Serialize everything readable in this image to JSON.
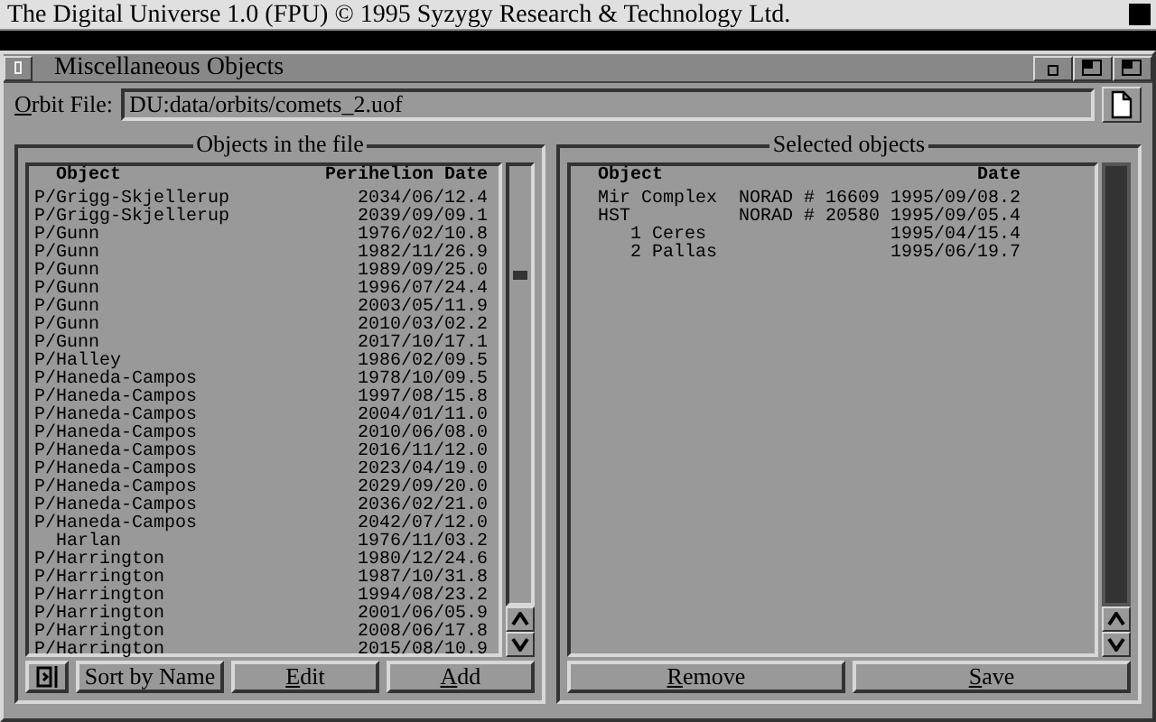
{
  "screen_title": "The Digital Universe 1.0 (FPU) © 1995 Syzygy Research & Technology Ltd.",
  "window": {
    "title": "Miscellaneous Objects"
  },
  "orbit_file": {
    "label": "Orbit File:",
    "value": "DU:data/orbits/comets_2.uof"
  },
  "file_panel": {
    "title": "Objects in the file",
    "columns": [
      "Object",
      "Perihelion Date"
    ],
    "rows": [
      {
        "object": "P/Grigg-Skjellerup",
        "date": "2034/06/12.4"
      },
      {
        "object": "P/Grigg-Skjellerup",
        "date": "2039/09/09.1"
      },
      {
        "object": "P/Gunn",
        "date": "1976/02/10.8"
      },
      {
        "object": "P/Gunn",
        "date": "1982/11/26.9"
      },
      {
        "object": "P/Gunn",
        "date": "1989/09/25.0"
      },
      {
        "object": "P/Gunn",
        "date": "1996/07/24.4"
      },
      {
        "object": "P/Gunn",
        "date": "2003/05/11.9"
      },
      {
        "object": "P/Gunn",
        "date": "2010/03/02.2"
      },
      {
        "object": "P/Gunn",
        "date": "2017/10/17.1"
      },
      {
        "object": "P/Halley",
        "date": "1986/02/09.5"
      },
      {
        "object": "P/Haneda-Campos",
        "date": "1978/10/09.5"
      },
      {
        "object": "P/Haneda-Campos",
        "date": "1997/08/15.8"
      },
      {
        "object": "P/Haneda-Campos",
        "date": "2004/01/11.0"
      },
      {
        "object": "P/Haneda-Campos",
        "date": "2010/06/08.0"
      },
      {
        "object": "P/Haneda-Campos",
        "date": "2016/11/12.0"
      },
      {
        "object": "P/Haneda-Campos",
        "date": "2023/04/19.0"
      },
      {
        "object": "P/Haneda-Campos",
        "date": "2029/09/20.0"
      },
      {
        "object": "P/Haneda-Campos",
        "date": "2036/02/21.0"
      },
      {
        "object": "P/Haneda-Campos",
        "date": "2042/07/12.0"
      },
      {
        "object": "  Harlan",
        "date": "1976/11/03.2"
      },
      {
        "object": "P/Harrington",
        "date": "1980/12/24.6"
      },
      {
        "object": "P/Harrington",
        "date": "1987/10/31.8"
      },
      {
        "object": "P/Harrington",
        "date": "1994/08/23.2"
      },
      {
        "object": "P/Harrington",
        "date": "2001/06/05.9"
      },
      {
        "object": "P/Harrington",
        "date": "2008/06/17.8"
      },
      {
        "object": "P/Harrington",
        "date": "2015/08/10.9"
      }
    ],
    "buttons": [
      "Sort by Name",
      "Edit",
      "Add"
    ]
  },
  "selected_panel": {
    "title": "Selected objects",
    "columns": [
      "Object",
      "Date"
    ],
    "rows": [
      {
        "object": "Mir Complex",
        "norad": "NORAD # 16609",
        "date": "1995/09/08.2"
      },
      {
        "object": "HST",
        "norad": "NORAD # 20580",
        "date": "1995/09/05.4"
      },
      {
        "object": "   1 Ceres",
        "date": "1995/04/15.4"
      },
      {
        "object": "   2 Pallas",
        "date": "1995/06/19.7"
      }
    ],
    "buttons": [
      "Remove",
      "Save"
    ]
  }
}
